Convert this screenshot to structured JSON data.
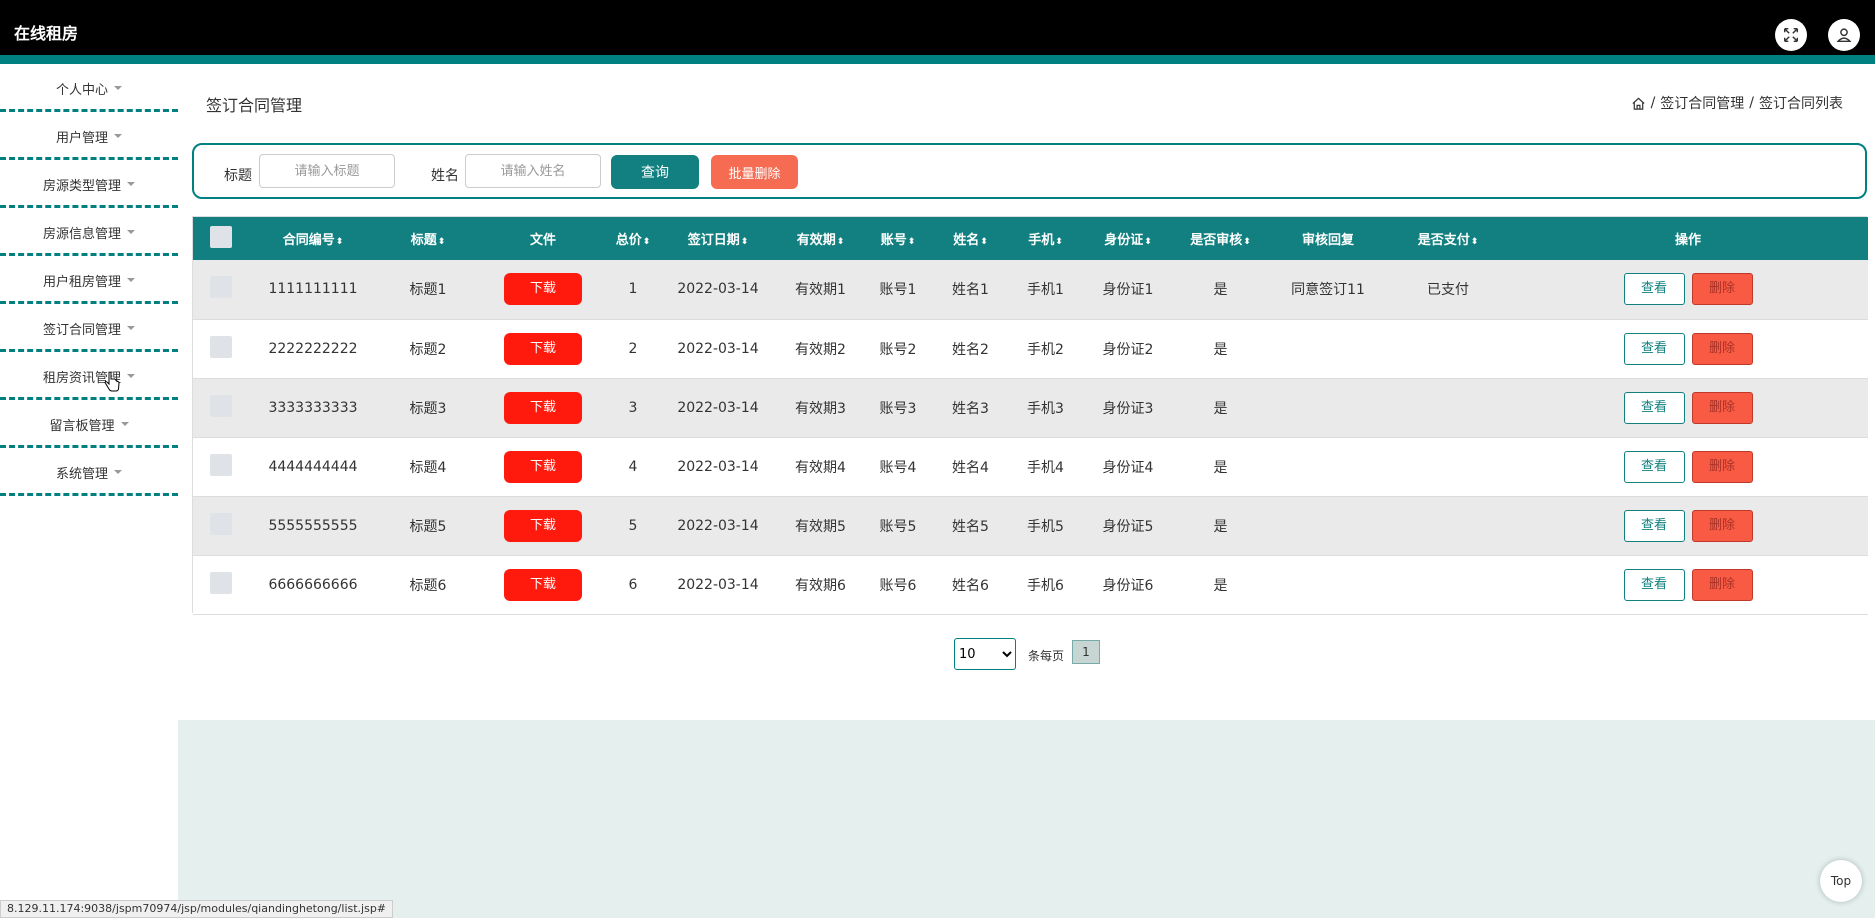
{
  "header": {
    "app_title": "在线租房",
    "fullscreen_icon": "fullscreen-icon",
    "user_icon": "user-icon"
  },
  "sidebar": {
    "items": [
      {
        "label": "个人中心"
      },
      {
        "label": "用户管理"
      },
      {
        "label": "房源类型管理"
      },
      {
        "label": "房源信息管理"
      },
      {
        "label": "用户租房管理"
      },
      {
        "label": "签订合同管理"
      },
      {
        "label": "租房资讯管理"
      },
      {
        "label": "留言板管理"
      },
      {
        "label": "系统管理"
      }
    ]
  },
  "page": {
    "title": "签订合同管理",
    "breadcrumb": {
      "home_icon": "home-icon",
      "sep": "/",
      "level1": "签订合同管理",
      "level2": "签订合同列表"
    }
  },
  "search": {
    "title_label": "标题",
    "title_placeholder": "请输入标题",
    "name_label": "姓名",
    "name_placeholder": "请输入姓名",
    "query_button": "查询",
    "batch_delete_button": "批量删除"
  },
  "table": {
    "headers": {
      "contract_no": "合同编号",
      "title": "标题",
      "file": "文件",
      "total_price": "总价",
      "sign_date": "签订日期",
      "validity": "有效期",
      "account": "账号",
      "name": "姓名",
      "phone": "手机",
      "id_card": "身份证",
      "reviewed": "是否审核",
      "review_reply": "审核回复",
      "paid": "是否支付",
      "actions": "操作"
    },
    "sort_glyph": "⬍",
    "download_label": "下载",
    "view_label": "查看",
    "delete_label": "删除",
    "rows": [
      {
        "contract_no": "1111111111",
        "title": "标题1",
        "total_price": "1",
        "sign_date": "2022-03-14",
        "validity": "有效期1",
        "account": "账号1",
        "name": "姓名1",
        "phone": "手机1",
        "id_card": "身份证1",
        "reviewed": "是",
        "review_reply": "同意签订11",
        "paid": "已支付"
      },
      {
        "contract_no": "2222222222",
        "title": "标题2",
        "total_price": "2",
        "sign_date": "2022-03-14",
        "validity": "有效期2",
        "account": "账号2",
        "name": "姓名2",
        "phone": "手机2",
        "id_card": "身份证2",
        "reviewed": "是",
        "review_reply": "",
        "paid": ""
      },
      {
        "contract_no": "3333333333",
        "title": "标题3",
        "total_price": "3",
        "sign_date": "2022-03-14",
        "validity": "有效期3",
        "account": "账号3",
        "name": "姓名3",
        "phone": "手机3",
        "id_card": "身份证3",
        "reviewed": "是",
        "review_reply": "",
        "paid": ""
      },
      {
        "contract_no": "4444444444",
        "title": "标题4",
        "total_price": "4",
        "sign_date": "2022-03-14",
        "validity": "有效期4",
        "account": "账号4",
        "name": "姓名4",
        "phone": "手机4",
        "id_card": "身份证4",
        "reviewed": "是",
        "review_reply": "",
        "paid": ""
      },
      {
        "contract_no": "5555555555",
        "title": "标题5",
        "total_price": "5",
        "sign_date": "2022-03-14",
        "validity": "有效期5",
        "account": "账号5",
        "name": "姓名5",
        "phone": "手机5",
        "id_card": "身份证5",
        "reviewed": "是",
        "review_reply": "",
        "paid": ""
      },
      {
        "contract_no": "6666666666",
        "title": "标题6",
        "total_price": "6",
        "sign_date": "2022-03-14",
        "validity": "有效期6",
        "account": "账号6",
        "name": "姓名6",
        "phone": "手机6",
        "id_card": "身份证6",
        "reviewed": "是",
        "review_reply": "",
        "paid": ""
      }
    ]
  },
  "pagination": {
    "page_size": "10",
    "page_size_options": [
      "10"
    ],
    "per_page_label": "条每页",
    "current_page": "1"
  },
  "footer": {
    "status_url": "8.129.11.174:9038/jspm70974/jsp/modules/qiandinghetong/list.jsp#",
    "top_button": "Top"
  },
  "colors": {
    "accent": "#008080",
    "header_bg": "#000000",
    "danger": "#ff1a0d"
  }
}
